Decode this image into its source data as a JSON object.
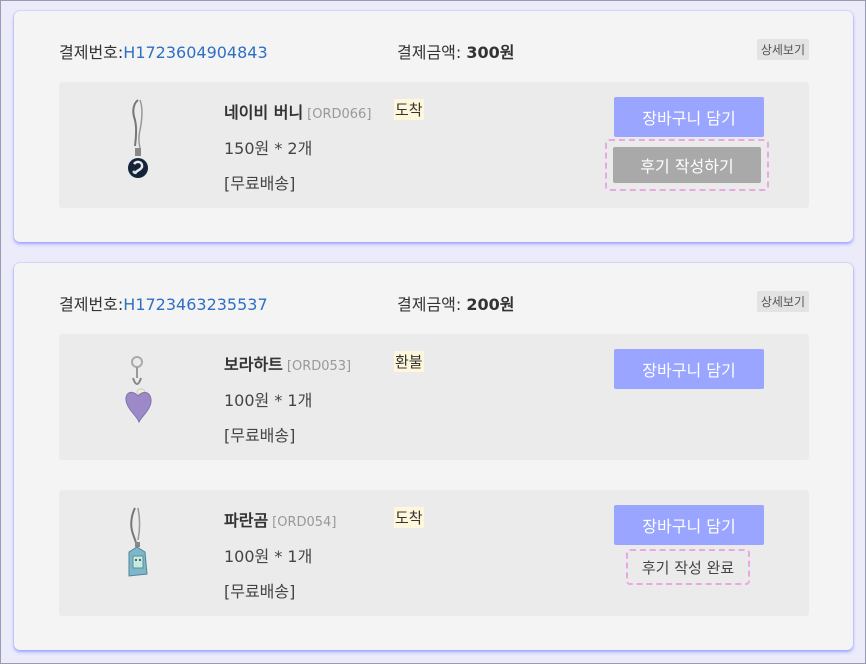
{
  "orders": [
    {
      "payment_no_label": "결제번호:",
      "payment_no": "H1723604904843",
      "amount_label": "결제금액:",
      "amount": "300원",
      "detail_button": "상세보기",
      "items": [
        {
          "name": "네이비 버니",
          "code": "[ORD066]",
          "status": "도착",
          "price_qty": "150원 * 2개",
          "shipping": "[무료배송]",
          "cart_button": "장바구니 담기",
          "review_button": "후기 작성하기",
          "image_icon": "navy-bunny-keychain-icon"
        }
      ]
    },
    {
      "payment_no_label": "결제번호:",
      "payment_no": "H1723463235537",
      "amount_label": "결제금액:",
      "amount": "200원",
      "detail_button": "상세보기",
      "items": [
        {
          "name": "보라하트",
          "code": "[ORD053]",
          "status": "환불",
          "price_qty": "100원 * 1개",
          "shipping": "[무료배송]",
          "cart_button": "장바구니 담기",
          "image_icon": "purple-heart-keychain-icon"
        },
        {
          "name": "파란곰",
          "code": "[ORD054]",
          "status": "도착",
          "price_qty": "100원 * 1개",
          "shipping": "[무료배송]",
          "cart_button": "장바구니 담기",
          "review_done": "후기 작성 완료",
          "image_icon": "blue-bear-keychain-icon"
        }
      ]
    }
  ],
  "colors": {
    "accent": "#99a5ff",
    "link": "#2f6fc4",
    "review_border": "#e9a8e0",
    "disabled_button": "#a9a9a9"
  }
}
